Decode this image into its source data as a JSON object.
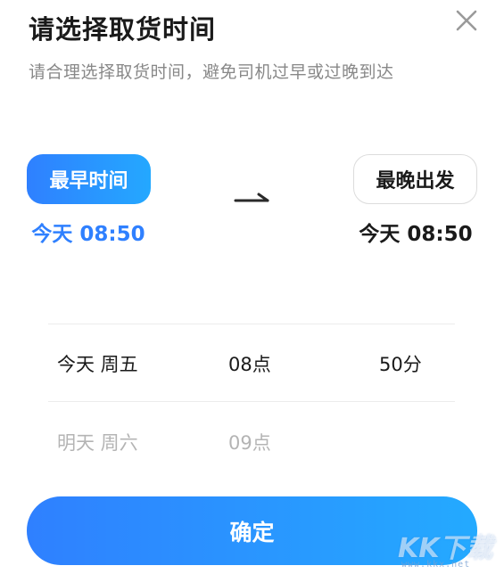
{
  "header": {
    "title": "请选择取货时间",
    "subtitle": "请合理选择取货时间，避免司机过早或过晚到达"
  },
  "range": {
    "earliest": {
      "label": "最早时间",
      "value": "今天 08:50",
      "selected": true
    },
    "latest": {
      "label": "最晚出发",
      "value": "今天 08:50",
      "selected": false
    }
  },
  "picker": {
    "rows": [
      {
        "day": "今天 周五",
        "hour": "08点",
        "minute": "50分",
        "state": "selected"
      },
      {
        "day": "明天 周六",
        "hour": "09点",
        "minute": "",
        "state": "next"
      }
    ]
  },
  "footer": {
    "confirm_label": "确定"
  },
  "watermark": {
    "brand": "KK下载",
    "url": "www.kkx.net"
  },
  "icons": {
    "close": "close-icon",
    "arrow": "arrow-right-icon"
  },
  "colors": {
    "accent": "#2f80ff",
    "accent_light": "#24a8ff",
    "title": "#1a1a1a",
    "subtitle": "#888888",
    "muted_row": "#b4b4b4",
    "divider": "#ececec"
  }
}
